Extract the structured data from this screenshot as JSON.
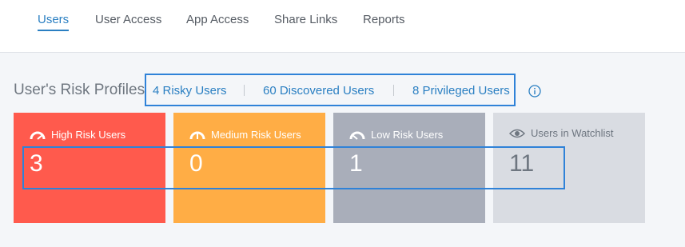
{
  "tabs": [
    {
      "label": "Users",
      "active": true
    },
    {
      "label": "User Access",
      "active": false
    },
    {
      "label": "App Access",
      "active": false
    },
    {
      "label": "Share Links",
      "active": false
    },
    {
      "label": "Reports",
      "active": false
    }
  ],
  "section": {
    "title": "User's Risk Profiles",
    "links": [
      "4 Risky Users",
      "60 Discovered Users",
      "8 Privileged Users"
    ],
    "info_icon": "info-circle-icon"
  },
  "cards": [
    {
      "label": "High Risk Users",
      "count": "3",
      "icon": "gauge-high-icon",
      "bg": "#ff5a4d",
      "fg": "#ffffff"
    },
    {
      "label": "Medium Risk Users",
      "count": "0",
      "icon": "gauge-medium-icon",
      "bg": "#ffad45",
      "fg": "#ffffff"
    },
    {
      "label": "Low Risk Users",
      "count": "1",
      "icon": "gauge-low-icon",
      "bg": "#a9aeba",
      "fg": "#ffffff"
    },
    {
      "label": "Users in Watchlist",
      "count": "11",
      "icon": "eye-icon",
      "bg": "#d9dce2",
      "fg": "#6e7680"
    }
  ],
  "colors": {
    "accent": "#2a7fc2",
    "highlight_box": "#2f82d8"
  }
}
